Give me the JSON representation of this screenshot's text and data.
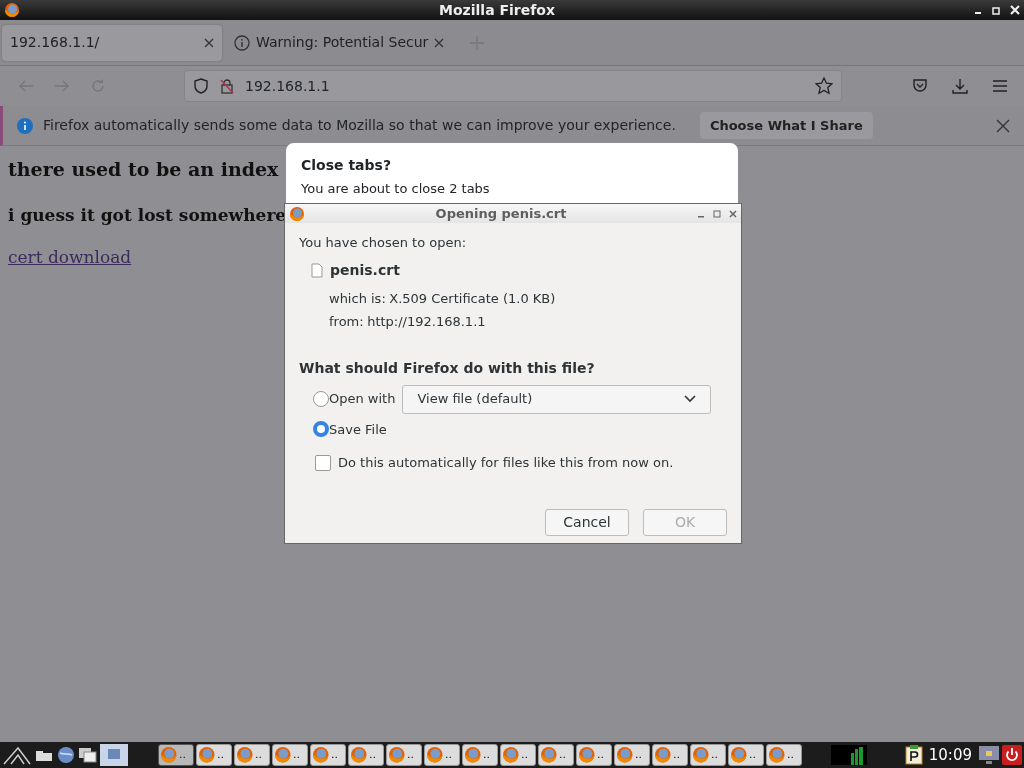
{
  "window": {
    "title": "Mozilla Firefox"
  },
  "tabs": [
    {
      "label": "192.168.1.1/",
      "selected": true,
      "kind": "page"
    },
    {
      "label": "Warning: Potential Secur",
      "selected": false,
      "kind": "warning"
    }
  ],
  "address_bar": {
    "value": "192.168.1.1"
  },
  "notification": {
    "message": "Firefox automatically sends some data to Mozilla so that we can improve your experience.",
    "button": "Choose What I Share"
  },
  "page": {
    "heading_1": "there used to be an index",
    "heading_2": "i guess it got lost somewhere",
    "link": "cert download"
  },
  "close_dialog": {
    "title": "Close tabs?",
    "message": "You are about to close 2 tabs"
  },
  "download_dialog": {
    "title": "Opening penis.crt",
    "intro": "You have chosen to open:",
    "filename": "penis.crt",
    "type_label": "which is:",
    "type": "X.509 Certificate (1.0 KB)",
    "from_label": "from:",
    "from": "http://192.168.1.1",
    "question": "What should Firefox do with this file?",
    "options": [
      {
        "label": "Open with",
        "selected": false
      },
      {
        "label": "Save File",
        "selected": true
      }
    ],
    "app_select": "View file (default)",
    "remember": {
      "label": "Do this automatically for files like this from now on.",
      "checked": false
    },
    "buttons": [
      {
        "label": "Cancel",
        "disabled": false
      },
      {
        "label": "OK",
        "disabled": true
      }
    ]
  },
  "taskbar": {
    "windows": [
      {
        "label": "..",
        "selected": true
      },
      {
        "label": "..",
        "selected": false
      },
      {
        "label": "..",
        "selected": false
      },
      {
        "label": "..",
        "selected": false
      },
      {
        "label": "..",
        "selected": false
      },
      {
        "label": "..",
        "selected": false
      },
      {
        "label": "..",
        "selected": false
      },
      {
        "label": "..",
        "selected": false
      },
      {
        "label": "..",
        "selected": false
      },
      {
        "label": "..",
        "selected": false
      },
      {
        "label": "..",
        "selected": false
      },
      {
        "label": "..",
        "selected": false
      },
      {
        "label": "..",
        "selected": false
      },
      {
        "label": "..",
        "selected": false
      },
      {
        "label": "..",
        "selected": false
      },
      {
        "label": "..",
        "selected": false
      },
      {
        "label": "..",
        "selected": false
      }
    ],
    "clock": "10:09"
  }
}
